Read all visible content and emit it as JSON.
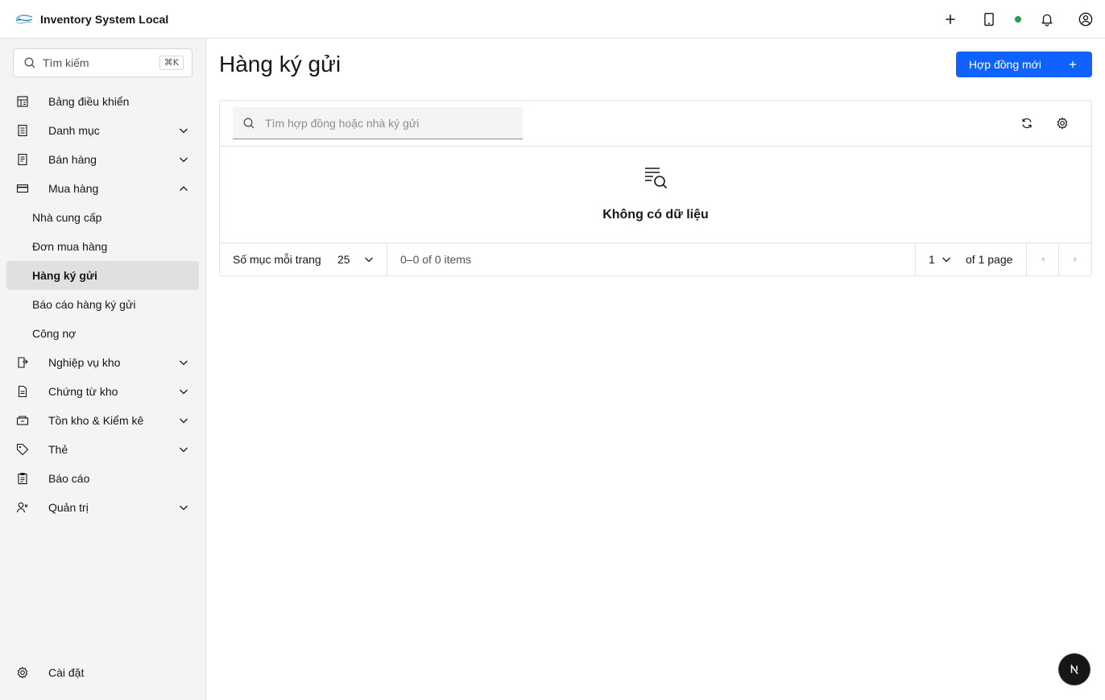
{
  "header": {
    "app_name": "Inventory System Local",
    "logo": "company-logo",
    "actions": [
      "add-icon",
      "tablet-icon",
      "online-status-dot",
      "notification-icon",
      "user-avatar-icon"
    ],
    "status_color": "#24a148"
  },
  "sidebar": {
    "search_label": "Tìm kiếm",
    "search_shortcut": "⌘K",
    "items": [
      {
        "label": "Bảng điều khiển",
        "icon": "dashboard-icon",
        "expandable": false
      },
      {
        "label": "Danh mục",
        "icon": "catalog-icon",
        "expandable": true
      },
      {
        "label": "Bán hàng",
        "icon": "receipt-icon",
        "expandable": true
      },
      {
        "label": "Mua hàng",
        "icon": "credit-card-icon",
        "expandable": true,
        "expanded": true
      },
      {
        "label": "Nghiệp vụ kho",
        "icon": "warehouse-transfer-icon",
        "expandable": true
      },
      {
        "label": "Chứng từ kho",
        "icon": "document-icon",
        "expandable": true
      },
      {
        "label": "Tồn kho & Kiểm kê",
        "icon": "inventory-icon",
        "expandable": true
      },
      {
        "label": "Thẻ",
        "icon": "tag-icon",
        "expandable": true
      },
      {
        "label": "Báo cáo",
        "icon": "report-icon",
        "expandable": false
      },
      {
        "label": "Quản trị",
        "icon": "admin-icon",
        "expandable": true
      }
    ],
    "purchase_subitems": [
      {
        "label": "Nhà cung cấp",
        "active": false
      },
      {
        "label": "Đơn mua hàng",
        "active": false
      },
      {
        "label": "Hàng ký gửi",
        "active": true
      },
      {
        "label": "Báo cáo hàng ký gửi",
        "active": false
      },
      {
        "label": "Công nợ",
        "active": false
      }
    ],
    "settings_label": "Cài đặt"
  },
  "main": {
    "title": "Hàng ký gửi",
    "primary_button": "Hợp đồng mới",
    "accent": "#0f62fe",
    "search_placeholder": "Tìm hợp đồng hoặc nhà ký gửi",
    "empty_text": "Không có dữ liệu",
    "pagination": {
      "items_per_page_label": "Số mục mỗi trang",
      "items_per_page": "25",
      "range_text": "0–0 of 0 items",
      "current_page": "1",
      "total_pages_text": "of 1 page"
    }
  }
}
